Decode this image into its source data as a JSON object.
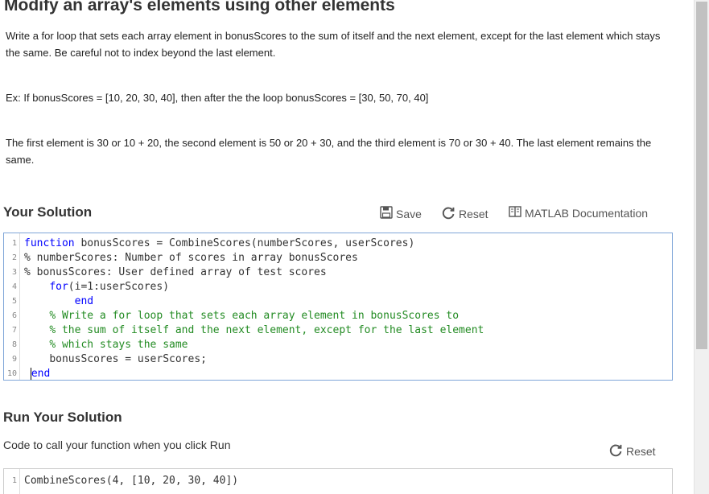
{
  "problem": {
    "title": "Modify an array's elements using other elements",
    "desc1": "Write a for loop that sets each array element in bonusScores to the sum of itself and the next element, except for the last element which stays the same. Be careful not to index beyond the last element.",
    "desc2": "Ex: If bonusScores = [10, 20, 30, 40], then after the the loop bonusScores = [30, 50, 70, 40]",
    "desc3": "The first element is 30 or 10 + 20, the second element is 50 or 20 + 30, and the third element is 70 or 30 + 40. The last element remains the same."
  },
  "solution": {
    "heading": "Your Solution",
    "save_label": "Save",
    "reset_label": "Reset",
    "doc_label": "MATLAB Documentation",
    "line_numbers": [
      "1",
      "2",
      "3",
      "4",
      "5",
      "6",
      "7",
      "8",
      "9",
      "10"
    ],
    "lines": {
      "l1_kw": "function",
      "l1_rest": " bonusScores = CombineScores(numberScores, userScores)",
      "l2": "% numberScores: Number of scores in array bonusScores",
      "l3": "% bonusScores: User defined array of test scores",
      "l4_kw": "for",
      "l4_rest": "(i=1:userScores)",
      "l5_kw": "end",
      "l6": "% Write a for loop that sets each array element in bonusScores to",
      "l7": "% the sum of itself and the next element, except for the last element",
      "l8": "% which stays the same",
      "l9": "bonusScores = userScores;",
      "l10_kw": "end"
    }
  },
  "run": {
    "heading": "Run Your Solution",
    "call_label": "Code to call your function when you click Run",
    "reset_label": "Reset",
    "line_number": "1",
    "call_code": "CombineScores(4, [10, 20, 30, 40])"
  },
  "icons": {
    "save": "floppy-disk-icon",
    "reset": "refresh-icon",
    "doc": "book-icon"
  }
}
